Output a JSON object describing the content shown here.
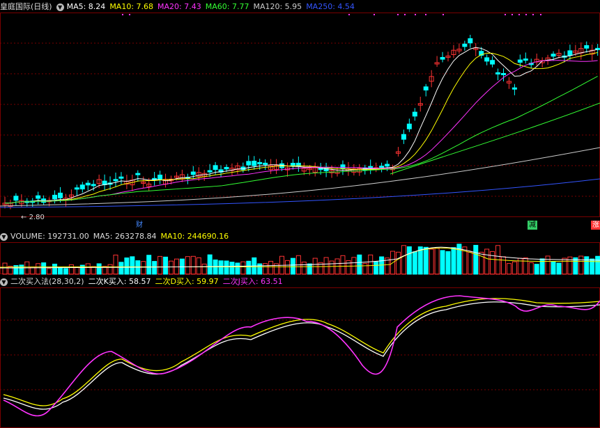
{
  "header": {
    "stock_name": "皇庭国际(日线)",
    "ma": [
      {
        "label": "MA5: 8.24",
        "color": "#ffffff"
      },
      {
        "label": "MA10: 7.68",
        "color": "#ffff00"
      },
      {
        "label": "MA20: 7.43",
        "color": "#ff33ff"
      },
      {
        "label": "MA60: 7.77",
        "color": "#33ff33"
      },
      {
        "label": "MA120: 5.95",
        "color": "#cccccc"
      },
      {
        "label": "MA250: 4.54",
        "color": "#3355ff"
      }
    ]
  },
  "volume_header": [
    {
      "label": "VOLUME: 192731.00",
      "color": "#dddddd"
    },
    {
      "label": "MA5: 263278.84",
      "color": "#dddddd"
    },
    {
      "label": "MA10: 244690.16",
      "color": "#ffff00"
    }
  ],
  "kdj_header": [
    {
      "label": "二次买入法(28,30,2)",
      "color": "#dddddd"
    },
    {
      "label": "二次K买入: 58.57",
      "color": "#ffffff"
    },
    {
      "label": "二次D买入: 59.97",
      "color": "#ffff00"
    },
    {
      "label": "二次J买入: 63.51",
      "color": "#ff33ff"
    }
  ],
  "low_label": "2.80",
  "event_markers": [
    {
      "label": "财",
      "color": "#4488ff"
    },
    {
      "label": "减",
      "color": "#33cc66"
    },
    {
      "label": "涨",
      "color": "#ff3333"
    }
  ],
  "colors": {
    "up": "#ff3333",
    "down": "#00ffff",
    "grid": "#7a0000"
  },
  "icons": {
    "header": "circle-down-icon"
  }
}
